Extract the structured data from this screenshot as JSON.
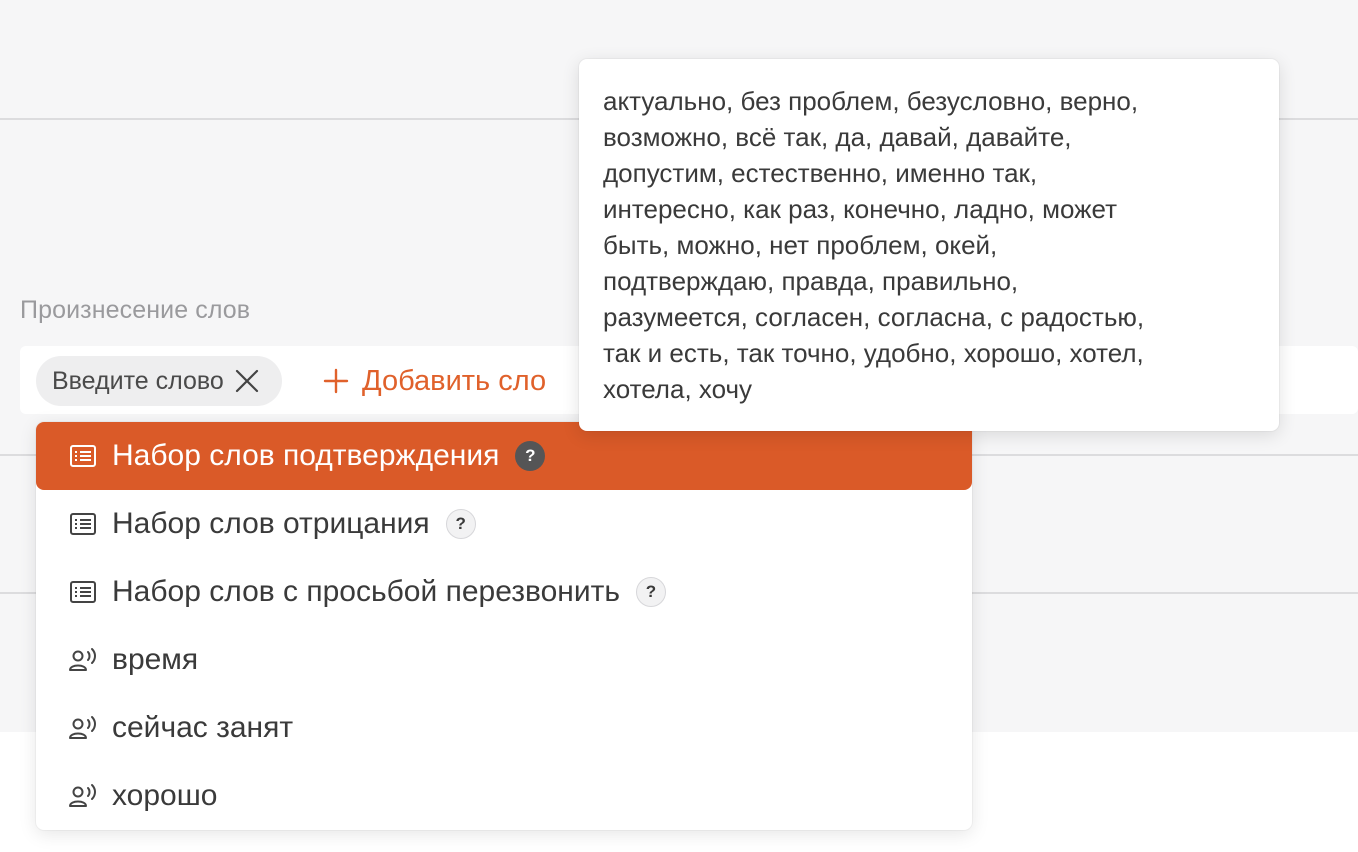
{
  "section": {
    "pronunciation_label": "Произнесение слов"
  },
  "word_input": {
    "chip_label": "Введите слово",
    "add_label": "Добавить сло"
  },
  "dropdown": {
    "items": [
      {
        "label": "Набор слов подтверждения",
        "icon": "list-icon",
        "help": "?",
        "active": true
      },
      {
        "label": "Набор слов отрицания",
        "icon": "list-icon",
        "help": "?"
      },
      {
        "label": "Набор слов с просьбой перезвонить",
        "icon": "list-icon",
        "help": "?"
      },
      {
        "label": "время",
        "icon": "voice-user-icon"
      },
      {
        "label": "сейчас занят",
        "icon": "voice-user-icon"
      },
      {
        "label": "хорошо",
        "icon": "voice-user-icon"
      }
    ]
  },
  "tooltip": {
    "lines": [
      "актуально, без проблем, безусловно, верно,",
      "возможно, всё так, да, давай, давайте,",
      "допустим, естественно, именно так,",
      "интересно, как раз, конечно, ладно, может",
      "быть, можно, нет проблем, окей,",
      "подтверждаю, правда, правильно,",
      "разумеется, согласен, согласна, с радостью,",
      "так и есть, так точно, удобно, хорошо, хотел,",
      "хотела, хочу"
    ]
  },
  "colors": {
    "accent": "#da5a28",
    "accent_text": "#e0612b",
    "panel_bg": "#f6f6f7"
  }
}
